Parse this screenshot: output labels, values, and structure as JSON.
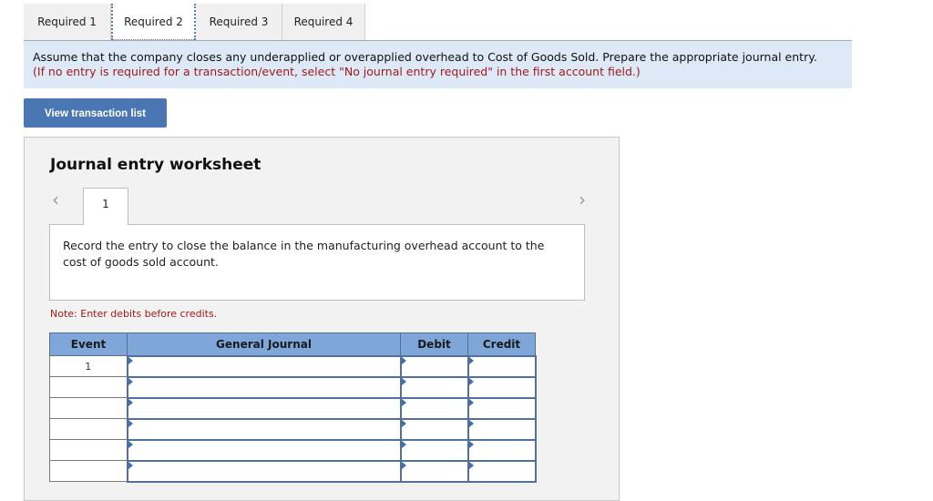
{
  "tabs": [
    {
      "label": "Required 1",
      "active": false
    },
    {
      "label": "Required 2",
      "active": true
    },
    {
      "label": "Required 3",
      "active": false
    },
    {
      "label": "Required 4",
      "active": false
    }
  ],
  "instructions": {
    "main": "Assume that the company closes any underapplied or overapplied overhead to Cost of Goods Sold. Prepare the appropriate journal entry.",
    "note": "(If no entry is required for a transaction/event, select \"No journal entry required\" in the first account field.)"
  },
  "buttons": {
    "view_transaction_list": "View transaction list"
  },
  "worksheet": {
    "title": "Journal entry worksheet",
    "prev_icon": "chevron-left-icon",
    "next_icon": "chevron-right-icon",
    "prev_glyph": "‹",
    "next_glyph": "›",
    "current_event": "1",
    "description": "Record the entry to close the balance in the manufacturing overhead account to the cost of goods sold account.",
    "note": "Note: Enter debits before credits."
  },
  "table": {
    "headers": {
      "event": "Event",
      "general_journal": "General Journal",
      "debit": "Debit",
      "credit": "Credit"
    },
    "rows": [
      {
        "event": "1",
        "account": "",
        "debit": "",
        "credit": ""
      },
      {
        "event": "",
        "account": "",
        "debit": "",
        "credit": ""
      },
      {
        "event": "",
        "account": "",
        "debit": "",
        "credit": ""
      },
      {
        "event": "",
        "account": "",
        "debit": "",
        "credit": ""
      },
      {
        "event": "",
        "account": "",
        "debit": "",
        "credit": ""
      },
      {
        "event": "",
        "account": "",
        "debit": "",
        "credit": ""
      }
    ]
  },
  "colors": {
    "accent_button": "#4a77b4",
    "instruction_bg": "#dde9f6",
    "note_red": "#a11b1b",
    "table_header": "#7ea6d9"
  }
}
